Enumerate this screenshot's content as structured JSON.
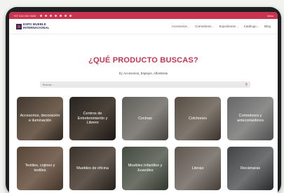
{
  "topbar": {
    "phone": "+57 318 334 0645",
    "right_text": "Inicio",
    "social_icons": [
      "facebook-icon",
      "instagram-icon",
      "pinterest-icon",
      "youtube-icon",
      "tiktok-icon",
      "whatsapp-icon",
      "mail-icon"
    ]
  },
  "header": {
    "logo_line1": "EXPO MUEBLE",
    "logo_line2": "INTERNACIONAL",
    "nav": [
      {
        "label": "Accesorios"
      },
      {
        "label": "Comedores"
      },
      {
        "label": "Expositores"
      },
      {
        "label": "Catálogo"
      },
      {
        "label": "Blog"
      }
    ]
  },
  "main": {
    "title": "¿QUÉ PRODUCTO BUSCAS?",
    "subtitle": "Ej: Accesorios, Espejos, Alfombras",
    "search_placeholder": "Buscar..."
  },
  "categories": [
    {
      "label": "Accesorios, decoración e iluminación"
    },
    {
      "label": "Centros de Entretenimiento y Librero"
    },
    {
      "label": "Cocinas"
    },
    {
      "label": "Colchones"
    },
    {
      "label": "Comedores y antecomedores"
    },
    {
      "label": "Textiles, cojines y textiles"
    },
    {
      "label": "Muebles de oficina"
    },
    {
      "label": "Muebles Infantiles y Juveniles"
    },
    {
      "label": "Literas"
    },
    {
      "label": "Recámaras"
    }
  ],
  "colors": {
    "accent": "#c8344f",
    "brand_navy": "#2c2f5e"
  }
}
